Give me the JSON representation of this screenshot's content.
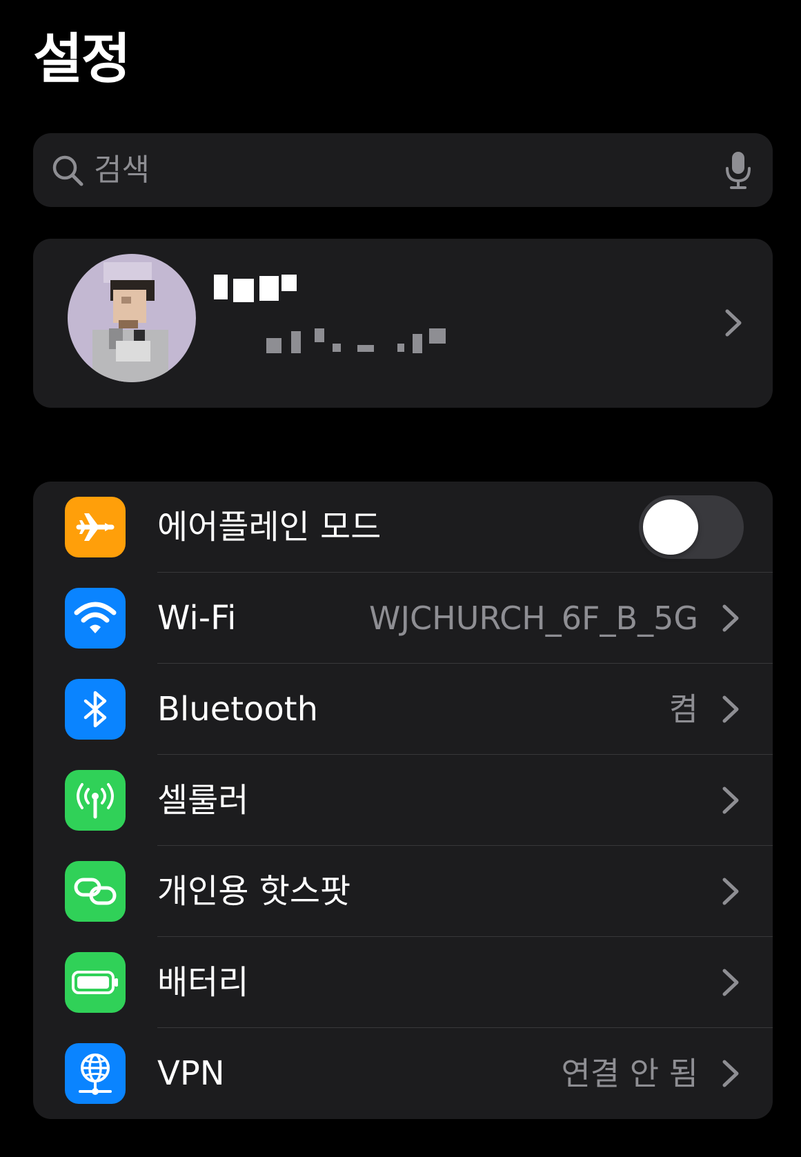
{
  "page_title": "설정",
  "search": {
    "placeholder": "검색",
    "value": ""
  },
  "profile": {
    "name": "",
    "subtitle": ""
  },
  "settings": [
    {
      "id": "airplane",
      "label": "에어플레인 모드",
      "value": "",
      "icon": "airplane-icon",
      "color": "#ff9f0a",
      "toggle": false
    },
    {
      "id": "wifi",
      "label": "Wi-Fi",
      "value": "WJCHURCH_6F_B_5G",
      "icon": "wifi-icon",
      "color": "#0a84ff"
    },
    {
      "id": "bluetooth",
      "label": "Bluetooth",
      "value": "켬",
      "icon": "bluetooth-icon",
      "color": "#0a84ff"
    },
    {
      "id": "cellular",
      "label": "셀룰러",
      "value": "",
      "icon": "antenna-icon",
      "color": "#30d158"
    },
    {
      "id": "hotspot",
      "label": "개인용 핫스팟",
      "value": "",
      "icon": "link-icon",
      "color": "#30d158"
    },
    {
      "id": "battery",
      "label": "배터리",
      "value": "",
      "icon": "battery-icon",
      "color": "#30d158"
    },
    {
      "id": "vpn",
      "label": "VPN",
      "value": "연결 안 됨",
      "icon": "globe-icon",
      "color": "#0a84ff"
    }
  ],
  "colors": {
    "background": "#000000",
    "card": "#1c1c1e",
    "secondary_text": "#8e8e93",
    "separator": "#38383a",
    "toggle_off": "#39393d"
  }
}
